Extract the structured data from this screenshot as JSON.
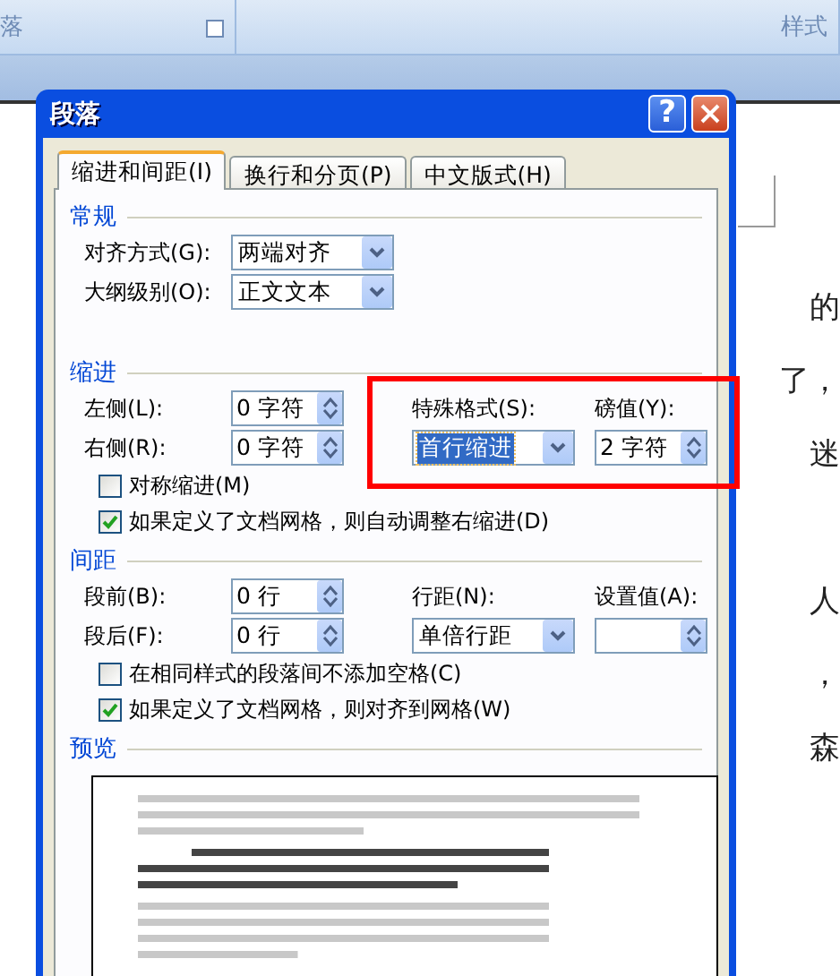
{
  "ribbon": {
    "groups": [
      {
        "label": "落",
        "launcher": true
      },
      {
        "label": "样式",
        "launcher": false
      }
    ]
  },
  "document": {
    "lines": [
      {
        "kind": "text",
        "right": "的"
      },
      {
        "kind": "text",
        "right": "了，"
      },
      {
        "kind": "text",
        "right": "迷"
      },
      {
        "kind": "blank"
      },
      {
        "kind": "text",
        "right": "人"
      },
      {
        "kind": "text",
        "right": "，"
      },
      {
        "kind": "text",
        "right": "森"
      }
    ]
  },
  "dialog": {
    "title": "段落",
    "help": "?",
    "tabs": [
      {
        "label": "缩进和间距(I)",
        "selected": true
      },
      {
        "label": "换行和分页(P)",
        "selected": false
      },
      {
        "label": "中文版式(H)",
        "selected": false
      }
    ],
    "sections": [
      {
        "title": "常规",
        "rows": [
          [
            {
              "kind": "label",
              "text": "对齐方式(G):"
            },
            {
              "kind": "combo",
              "value": "两端对齐",
              "focused": false
            }
          ],
          [
            {
              "kind": "label",
              "text": "大纲级别(O):"
            },
            {
              "kind": "combo",
              "value": "正文文本",
              "focused": false
            }
          ],
          [
            {
              "kind": "blank"
            }
          ]
        ]
      },
      {
        "title": "缩进",
        "rows": [
          [
            {
              "kind": "label",
              "text": "左侧(L):"
            },
            {
              "kind": "spin",
              "value": "0 字符"
            },
            {
              "kind": "label",
              "text": "特殊格式(S):"
            },
            {
              "kind": "label",
              "text": "磅值(Y):"
            }
          ],
          [
            {
              "kind": "label",
              "text": "右侧(R):"
            },
            {
              "kind": "spin",
              "value": "0 字符"
            },
            {
              "kind": "combo",
              "value": "首行缩进",
              "focused": true
            },
            {
              "kind": "spin",
              "value": "2 字符"
            }
          ],
          [
            {
              "kind": "checkbox",
              "text": "对称缩进(M)",
              "checked": false
            }
          ],
          [
            {
              "kind": "checkbox",
              "text": "如果定义了文档网格，则自动调整右缩进(D)",
              "checked": true
            }
          ]
        ]
      },
      {
        "title": "间距",
        "rows": [
          [
            {
              "kind": "label",
              "text": "段前(B):"
            },
            {
              "kind": "spin",
              "value": "0 行"
            },
            {
              "kind": "label",
              "text": "行距(N):"
            },
            {
              "kind": "label",
              "text": "设置值(A):"
            }
          ],
          [
            {
              "kind": "label",
              "text": "段后(F):"
            },
            {
              "kind": "spin",
              "value": "0 行"
            },
            {
              "kind": "combo",
              "value": "单倍行距",
              "focused": false
            },
            {
              "kind": "spin"
            }
          ],
          [
            {
              "kind": "checkbox",
              "text": "在相同样式的段落间不添加空格(C)",
              "checked": false
            }
          ],
          [
            {
              "kind": "checkbox",
              "text": "如果定义了文档网格，则对齐到网格(W)",
              "checked": true
            }
          ]
        ]
      },
      {
        "title": "预览",
        "rows": [
          [
            {
              "kind": "preview"
            }
          ]
        ]
      }
    ]
  }
}
